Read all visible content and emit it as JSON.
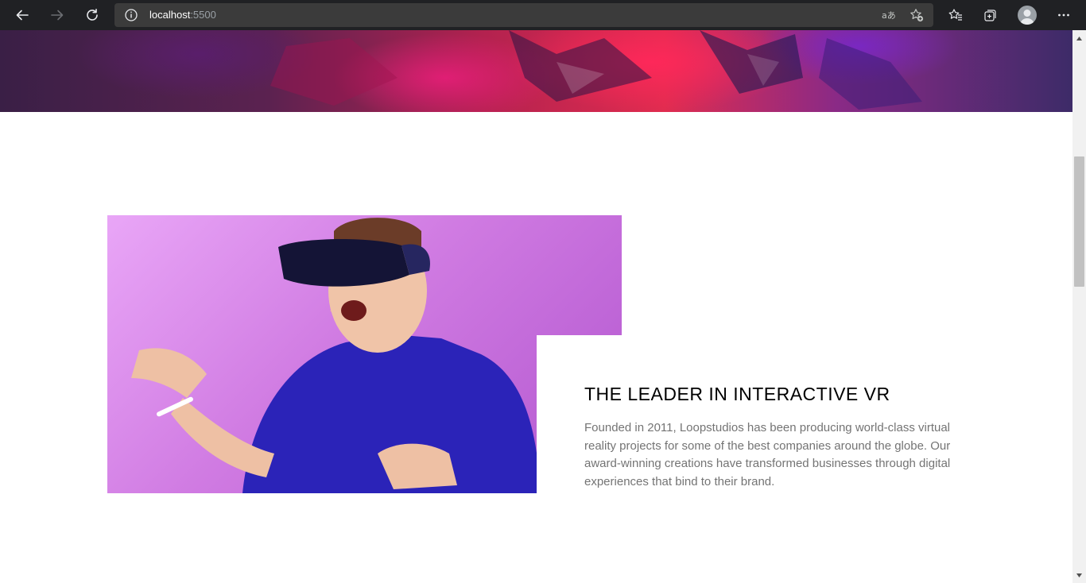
{
  "browser": {
    "address_host": "localhost",
    "address_port": ":5500",
    "buttons": {
      "back": "back-arrow-icon",
      "forward": "forward-arrow-icon",
      "refresh": "refresh-icon",
      "site_info": "info-icon",
      "read_aloud": "read-aloud-icon",
      "add_favorite": "add-favorite-icon",
      "favorites": "favorites-icon",
      "collections": "collections-icon",
      "profile": "profile-avatar",
      "more": "more-icon"
    },
    "colors": {
      "toolbar": "#202124",
      "address_bar": "#3b3b3b"
    }
  },
  "page": {
    "section_title": "THE LEADER IN INTERACTIVE VR",
    "section_body": "Founded in 2011, Loopstudios has been producing world-class virtual reality projects for some of the best companies around the globe. Our award-winning creations have transformed businesses through digital experiences that bind to their brand.",
    "colors": {
      "title": "#000000",
      "body": "#747474"
    }
  }
}
